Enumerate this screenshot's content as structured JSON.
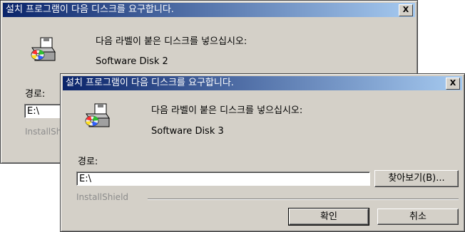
{
  "back_dialog": {
    "title": "설치 프로그램이 다음 디스크를 요구합니다.",
    "close_label": "X",
    "message_line1": "다음 라벨이 붙은 디스크를 넣으십시오:",
    "message_line2": "Software Disk 2",
    "path_label": "경로:",
    "path_value": "E:\\",
    "brand": "InstallShield"
  },
  "front_dialog": {
    "title": "설치 프로그램이 다음 디스크를 요구합니다.",
    "close_label": "X",
    "message_line1": "다음 라벨이 붙은 디스크를 넣으십시오:",
    "message_line2": "Software Disk 3",
    "path_label": "경로:",
    "path_value": "E:\\",
    "browse_label": "찾아보기(B)...",
    "brand": "InstallShield",
    "ok_label": "확인",
    "cancel_label": "취소"
  }
}
